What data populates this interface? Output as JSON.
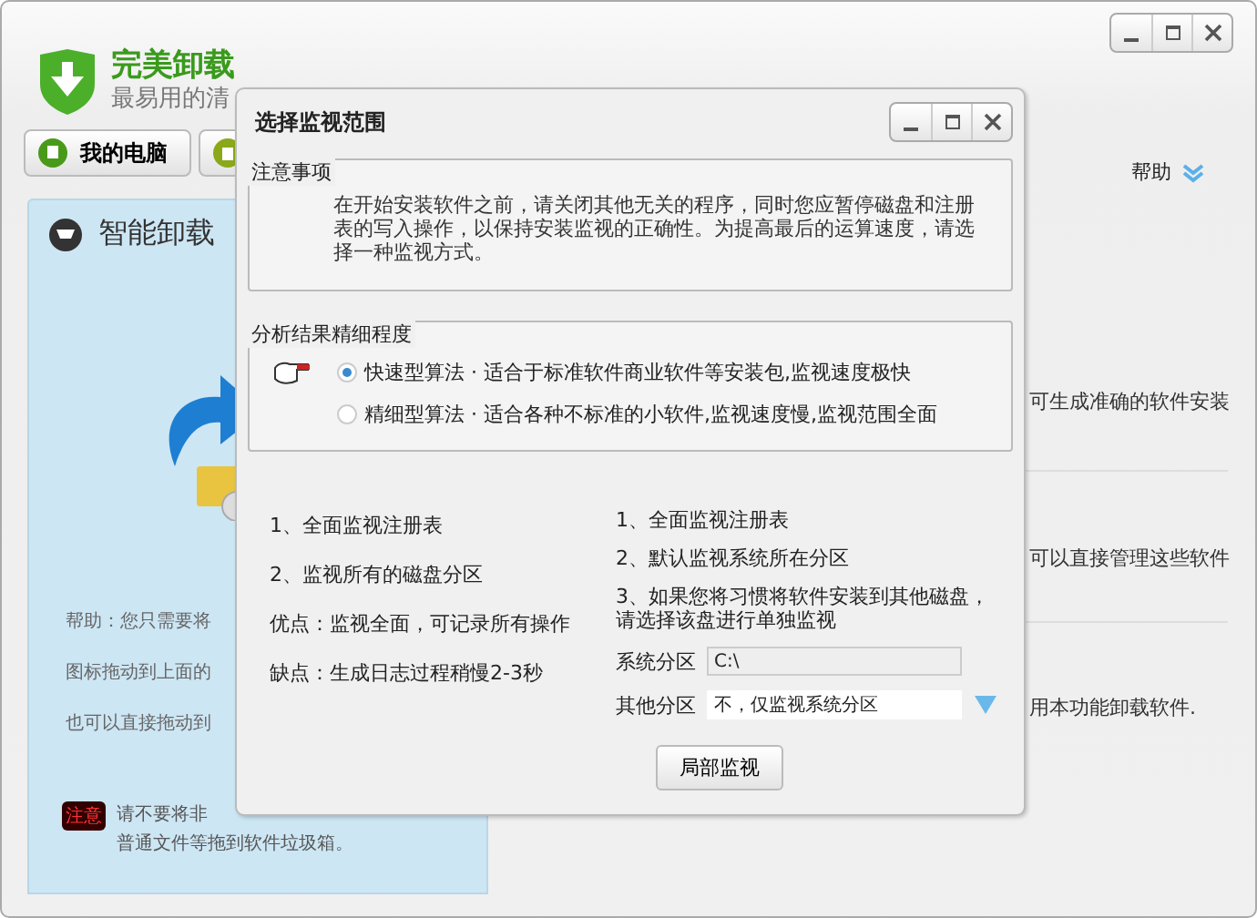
{
  "main_window": {
    "app_title": "完美卸载",
    "app_subtitle": "最易用的清",
    "tabs": [
      {
        "label": "我的电脑"
      }
    ],
    "help_link": "帮助",
    "panel": {
      "title": "智能卸载",
      "help_lines": [
        "帮助：您只需要将",
        "图标拖动到上面的",
        "也可以直接拖动到"
      ],
      "notice_badge": "注意",
      "notice_lines": [
        "请不要将非",
        "普通文件等拖到软件垃圾箱。"
      ]
    },
    "features": [
      "可生成准确的软件安装",
      "可以直接管理这些软件",
      "用本功能卸载软件."
    ]
  },
  "dialog": {
    "title": "选择监视范围",
    "notice": {
      "legend": "注意事项",
      "text": "在开始安装软件之前，请关闭其他无关的程序，同时您应暂停磁盘和注册表的写入操作，以保持安装监视的正确性。为提高最后的运算速度，请选择一种监视方式。"
    },
    "precision": {
      "legend": "分析结果精细程度",
      "options": [
        {
          "label": "快速型算法 · 适合于标准软件商业软件等安装包,监视速度极快",
          "selected": true
        },
        {
          "label": "精细型算法 · 适合各种不标准的小软件,监视速度慢,监视范围全面",
          "selected": false
        }
      ]
    },
    "full_mode": {
      "lines": [
        "1、全面监视注册表",
        "2、监视所有的磁盘分区",
        "优点：监视全面，可记录所有操作",
        "缺点：生成日志过程稍慢2-3秒"
      ]
    },
    "partial_mode": {
      "lines": [
        "1、全面监视注册表",
        "2、默认监视系统所在分区",
        "3、如果您将习惯将软件安装到其他磁盘，请选择该盘进行单独监视"
      ],
      "fields": [
        {
          "label": "系统分区",
          "value": "C:\\",
          "kind": "text"
        },
        {
          "label": "其他分区",
          "value": "不，仅监视系统分区",
          "kind": "dropdown"
        }
      ],
      "button": "局部监视"
    }
  }
}
